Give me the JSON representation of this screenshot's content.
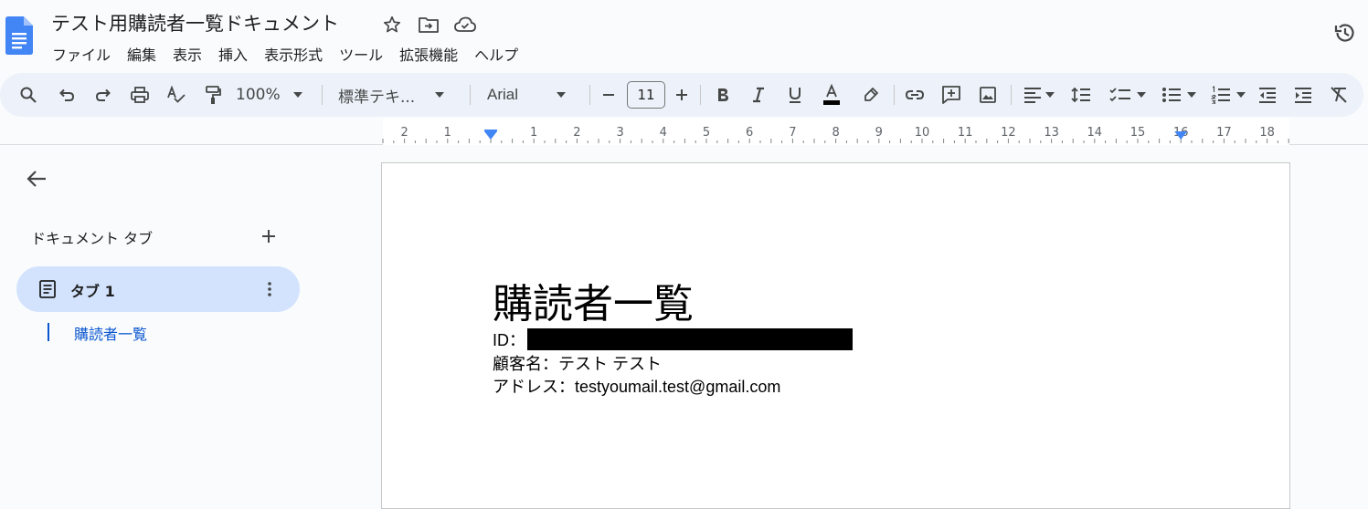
{
  "app": {
    "document_title": "テスト用購読者一覧ドキュメント"
  },
  "menu": [
    "ファイル",
    "編集",
    "表示",
    "挿入",
    "表示形式",
    "ツール",
    "拡張機能",
    "ヘルプ"
  ],
  "toolbar": {
    "zoom": "100%",
    "style": "標準テキ...",
    "font": "Arial",
    "font_size": "11",
    "text_color": "#000000"
  },
  "ruler": {
    "labels": [
      "2",
      "1",
      "1",
      "2",
      "3",
      "4",
      "5",
      "6",
      "7",
      "8",
      "9",
      "10",
      "11",
      "12",
      "13",
      "14",
      "15",
      "16",
      "17",
      "18"
    ]
  },
  "sidebar": {
    "heading": "ドキュメント タブ",
    "tabs": [
      {
        "label": "タブ 1"
      }
    ],
    "outline": [
      {
        "label": "購読者一覧"
      }
    ]
  },
  "document": {
    "heading": "購読者一覧",
    "id_label": "ID：",
    "customer_line": "顧客名：テスト テスト",
    "address_line": "アドレス：testyoumail.test@gmail.com"
  },
  "colors": {
    "accent": "#0b57d0",
    "toolbar_bg": "#edf2fa",
    "selected_tab_bg": "#d3e3fd"
  }
}
